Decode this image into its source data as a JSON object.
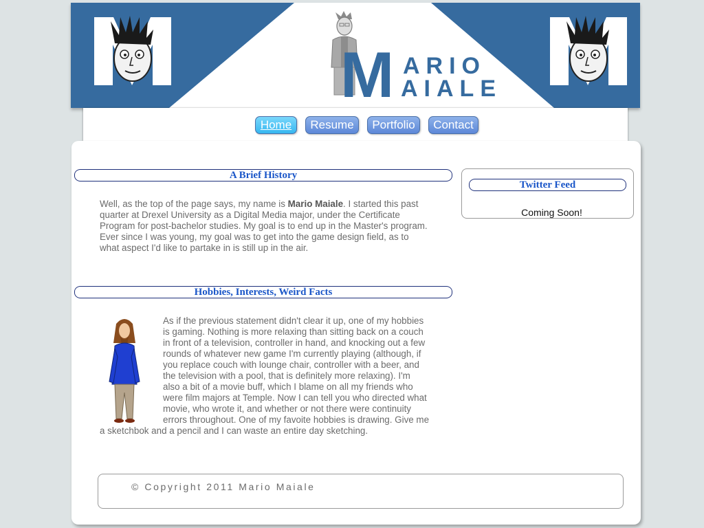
{
  "header": {
    "logo_letter": "M",
    "logo_line1": "ARIO",
    "logo_line2": "AIALE"
  },
  "nav": {
    "items": [
      {
        "label": "Home",
        "active": true
      },
      {
        "label": "Resume",
        "active": false
      },
      {
        "label": "Portfolio",
        "active": false
      },
      {
        "label": "Contact",
        "active": false
      }
    ]
  },
  "main": {
    "history": {
      "heading": "A Brief History",
      "text_before": "Well, as the top of the page says, my name is ",
      "name_bold": "Mario Maiale",
      "text_after": ". I started this past quarter at Drexel University as a Digital Media major, under the Certificate Program for post-bachelor studies. My goal is to end up in the Master's program. Ever since I was young, my goal was to get into the game design field, as to what aspect I'd like to partake in is still up in the air."
    },
    "hobbies": {
      "heading": "Hobbies, Interests, Weird Facts",
      "text": "As if the previous statement didn't clear it up, one of my hobbies is gaming. Nothing is more relaxing than sitting back on a couch in front of a television, controller in hand, and knocking out a few rounds of whatever new game I'm currently playing (although, if you replace couch with lounge chair, controller with a beer, and the television with a pool, that is definitely more relaxing). I'm also a bit of a movie buff, which I blame on all my friends who were film majors at Temple. Now I can tell you who directed what movie, who wrote it, and whether or not there were continuity errors throughout. One of my favoite hobbies is drawing. Give me a sketchbok and a pencil and I can waste an entire day sketching."
    }
  },
  "sidebar": {
    "heading": "Twitter Feed",
    "body": "Coming Soon!"
  },
  "footer": {
    "copyright": "© Copyright 2011 Mario Maiale"
  },
  "colors": {
    "banner_blue": "#366b9f",
    "heading_blue": "#1a56c8",
    "nav_blue": "#6e96dd",
    "nav_active": "#3ab8f0"
  }
}
